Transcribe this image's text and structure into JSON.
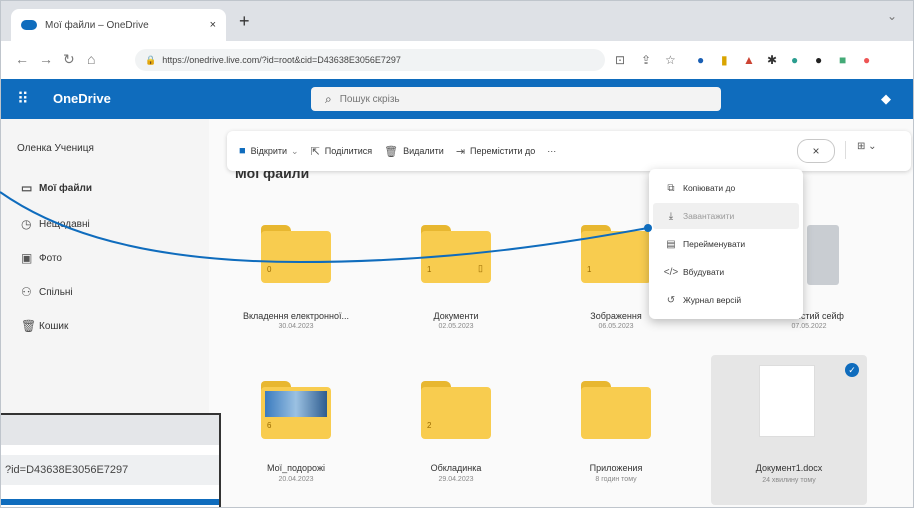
{
  "browser": {
    "tab_title": "Мої файли – OneDrive",
    "tab_close": "×",
    "new_tab": "+",
    "window_control": "⌄",
    "url": "https://onedrive.live.com/?id=root&cid=D43638E3056E7297",
    "lock_icon": "🔒"
  },
  "app": {
    "name": "OneDrive",
    "brand_color": "#0f6cbd",
    "search_placeholder": "Пошук скрізь"
  },
  "sidebar": {
    "user": "Оленка Учениця",
    "items": [
      {
        "label": "Мої файли",
        "icon": "folder-icon"
      },
      {
        "label": "Нещодавні",
        "icon": "clock-icon"
      },
      {
        "label": "Фото",
        "icon": "photo-icon"
      },
      {
        "label": "Спільні",
        "icon": "people-icon"
      },
      {
        "label": "Кошик",
        "icon": "trash-icon"
      }
    ]
  },
  "command_bar": {
    "open": "Відкрити",
    "share": "Поділитися",
    "delete": "Видалити",
    "move": "Перемістити до",
    "more": "···",
    "close": "×"
  },
  "main": {
    "heading": "Мої файли"
  },
  "files_row1": [
    {
      "name": "Вкладення електронної...",
      "date": "30.04.2023",
      "count": "0"
    },
    {
      "name": "Документи",
      "date": "02.05.2023",
      "count": "1"
    },
    {
      "name": "Зображення",
      "date": "06.05.2023",
      "count": "1"
    },
    {
      "name": "Особистий сейф",
      "date": "07.05.2022"
    }
  ],
  "files_row2": [
    {
      "name": "Мої_подорожі",
      "date": "20.04.2023",
      "count": "6"
    },
    {
      "name": "Обкладинка",
      "date": "29.04.2023",
      "count": "2"
    },
    {
      "name": "Приложения",
      "date": "8 годин тому"
    },
    {
      "name": "Документ1.docx",
      "date": "24 хвилину тому"
    }
  ],
  "context_menu": [
    {
      "label": "Копіювати до",
      "icon": "copy-icon"
    },
    {
      "label": "Завантажити",
      "icon": "download-icon"
    },
    {
      "label": "Перейменувати",
      "icon": "rename-icon"
    },
    {
      "label": "Вбудувати",
      "icon": "embed-icon"
    },
    {
      "label": "Журнал версій",
      "icon": "history-icon"
    }
  ],
  "inset": {
    "url_fragment": "?id=D43638E3056E7297"
  }
}
